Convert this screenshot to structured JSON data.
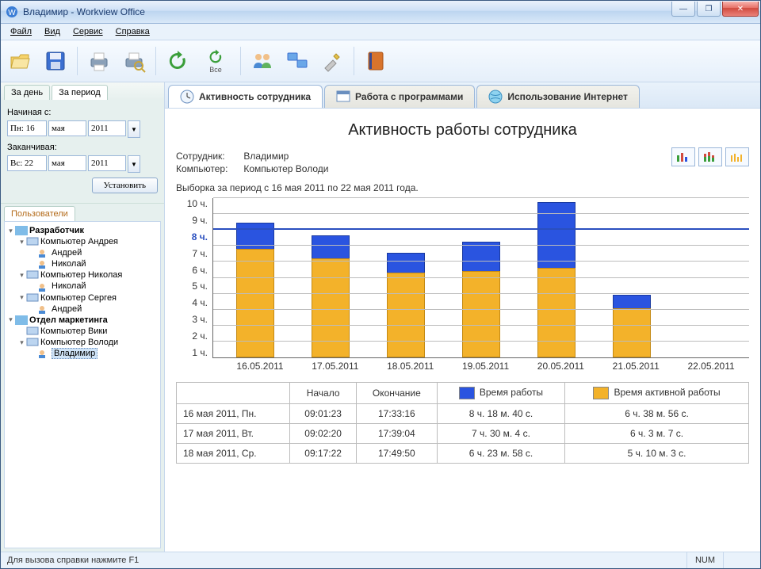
{
  "window": {
    "title": "Владимир - Workview Office"
  },
  "menu": {
    "file": "Файл",
    "view": "Вид",
    "service": "Сервис",
    "help": "Справка"
  },
  "toolbar": {
    "open": "open",
    "save": "save",
    "print": "print",
    "print_preview": "print-preview",
    "refresh": "refresh",
    "refresh_all": "refresh-all",
    "refresh_all_label": "Все",
    "users": "users",
    "computers": "computers",
    "settings": "settings",
    "help_book": "help"
  },
  "left": {
    "tabs": {
      "day": "За день",
      "period": "За период"
    },
    "from_label": "Начиная с:",
    "to_label": "Заканчивая:",
    "from": {
      "dow": "Пн: 16",
      "month": "мая",
      "year": "2011"
    },
    "to": {
      "dow": "Вс: 22",
      "month": "мая",
      "year": "2011"
    },
    "apply": "Установить",
    "users_tab": "Пользователи",
    "tree": {
      "dev": "Разработчик",
      "c_andrey": "Компьютер Андрея",
      "u_andrey": "Андрей",
      "u_nikolay": "Николай",
      "c_nikolay": "Компьютер Николая",
      "u_nikolay2": "Николай",
      "c_sergey": "Компьютер Сергея",
      "u_andrey2": "Андрей",
      "marketing": "Отдел маркетинга",
      "c_viki": "Компьютер Вики",
      "c_volodi": "Компьютер Володи",
      "u_vladimir": "Владимир"
    }
  },
  "maintabs": {
    "activity": "Активность сотрудника",
    "programs": "Работа с программами",
    "internet": "Использование Интернет"
  },
  "report": {
    "title": "Активность работы сотрудника",
    "employee_k": "Сотрудник:",
    "employee_v": "Владимир",
    "computer_k": "Компьютер:",
    "computer_v": "Компьютер Володи",
    "period": "Выборка за период с 16 мая 2011 по 22 мая 2011 года."
  },
  "chart_data": {
    "type": "bar",
    "categories": [
      "16.05.2011",
      "17.05.2011",
      "18.05.2011",
      "19.05.2011",
      "20.05.2011",
      "21.05.2011",
      "22.05.2011"
    ],
    "series": [
      {
        "name": "Время активной работы",
        "values": [
          6.7,
          6.1,
          5.2,
          5.3,
          5.5,
          3.0,
          0
        ]
      },
      {
        "name": "Время работы",
        "values": [
          8.3,
          7.5,
          6.4,
          7.1,
          9.6,
          3.8,
          0
        ]
      }
    ],
    "ylabel": "ч.",
    "ylim": [
      0,
      10
    ],
    "reference_line": 8,
    "y_ticks": [
      1,
      2,
      3,
      4,
      5,
      6,
      7,
      8,
      9,
      10
    ]
  },
  "table": {
    "headers": {
      "start": "Начало",
      "end": "Окончание",
      "work": "Время работы",
      "active": "Время активной работы"
    },
    "rows": [
      {
        "date": "16 мая 2011, Пн.",
        "start": "09:01:23",
        "end": "17:33:16",
        "work": "8 ч. 18 м. 40 с.",
        "active": "6 ч. 38 м. 56 с."
      },
      {
        "date": "17 мая 2011, Вт.",
        "start": "09:02:20",
        "end": "17:39:04",
        "work": "7 ч. 30 м.  4 с.",
        "active": "6 ч.  3 м.  7 с."
      },
      {
        "date": "18 мая 2011, Ср.",
        "start": "09:17:22",
        "end": "17:49:50",
        "work": "6 ч. 23 м. 58 с.",
        "active": "5 ч. 10 м.  3 с."
      }
    ]
  },
  "status": {
    "hint": "Для вызова справки нажмите F1",
    "num": "NUM"
  }
}
